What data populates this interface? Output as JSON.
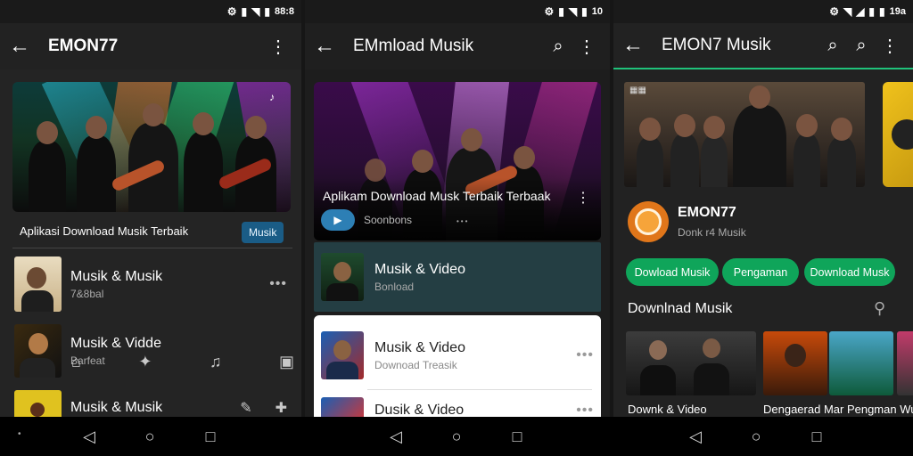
{
  "screens": [
    {
      "status": {
        "text": "88:8"
      },
      "header": {
        "title": "EMON77"
      },
      "hero": {
        "caption": "Aplikasi Download Musik Terbaik",
        "button_label": "Musik"
      },
      "list": [
        {
          "title": "Musik & Musik",
          "subtitle": "7&8bal"
        },
        {
          "title": "Musik & Vidde",
          "subtitle": "Barfeat"
        },
        {
          "title": "Musik & Musik",
          "subtitle": ""
        }
      ]
    },
    {
      "status": {
        "text": "10"
      },
      "header": {
        "title": "EMmload Musik"
      },
      "hero": {
        "caption": "Aplikam Download Musk Terbaik Terbaak",
        "sub": "Soonbons"
      },
      "list": [
        {
          "title": "Musik & Video",
          "subtitle": "Bonload"
        },
        {
          "title": "Musik & Video",
          "subtitle": "Downoad Treasik"
        },
        {
          "title": "Dusik & Video",
          "subtitle": ""
        }
      ]
    },
    {
      "status": {
        "text": "19a"
      },
      "header": {
        "title": "EMON7 Musik"
      },
      "profile": {
        "name": "EMON77",
        "sub": "Donk r4 Musik"
      },
      "pills": [
        "Dowload Musik",
        "Pengaman",
        "Download Musk"
      ],
      "section_title": "Downlnad Musik",
      "tiles": [
        {
          "caption": "Downk & Video"
        },
        {
          "caption": "Dengaerad Mar Pengman Wurs"
        }
      ]
    }
  ],
  "theme": {
    "accent_green": "#0fa55a",
    "accent_blue": "#1a5c86",
    "divider_green": "#1fc27a"
  }
}
